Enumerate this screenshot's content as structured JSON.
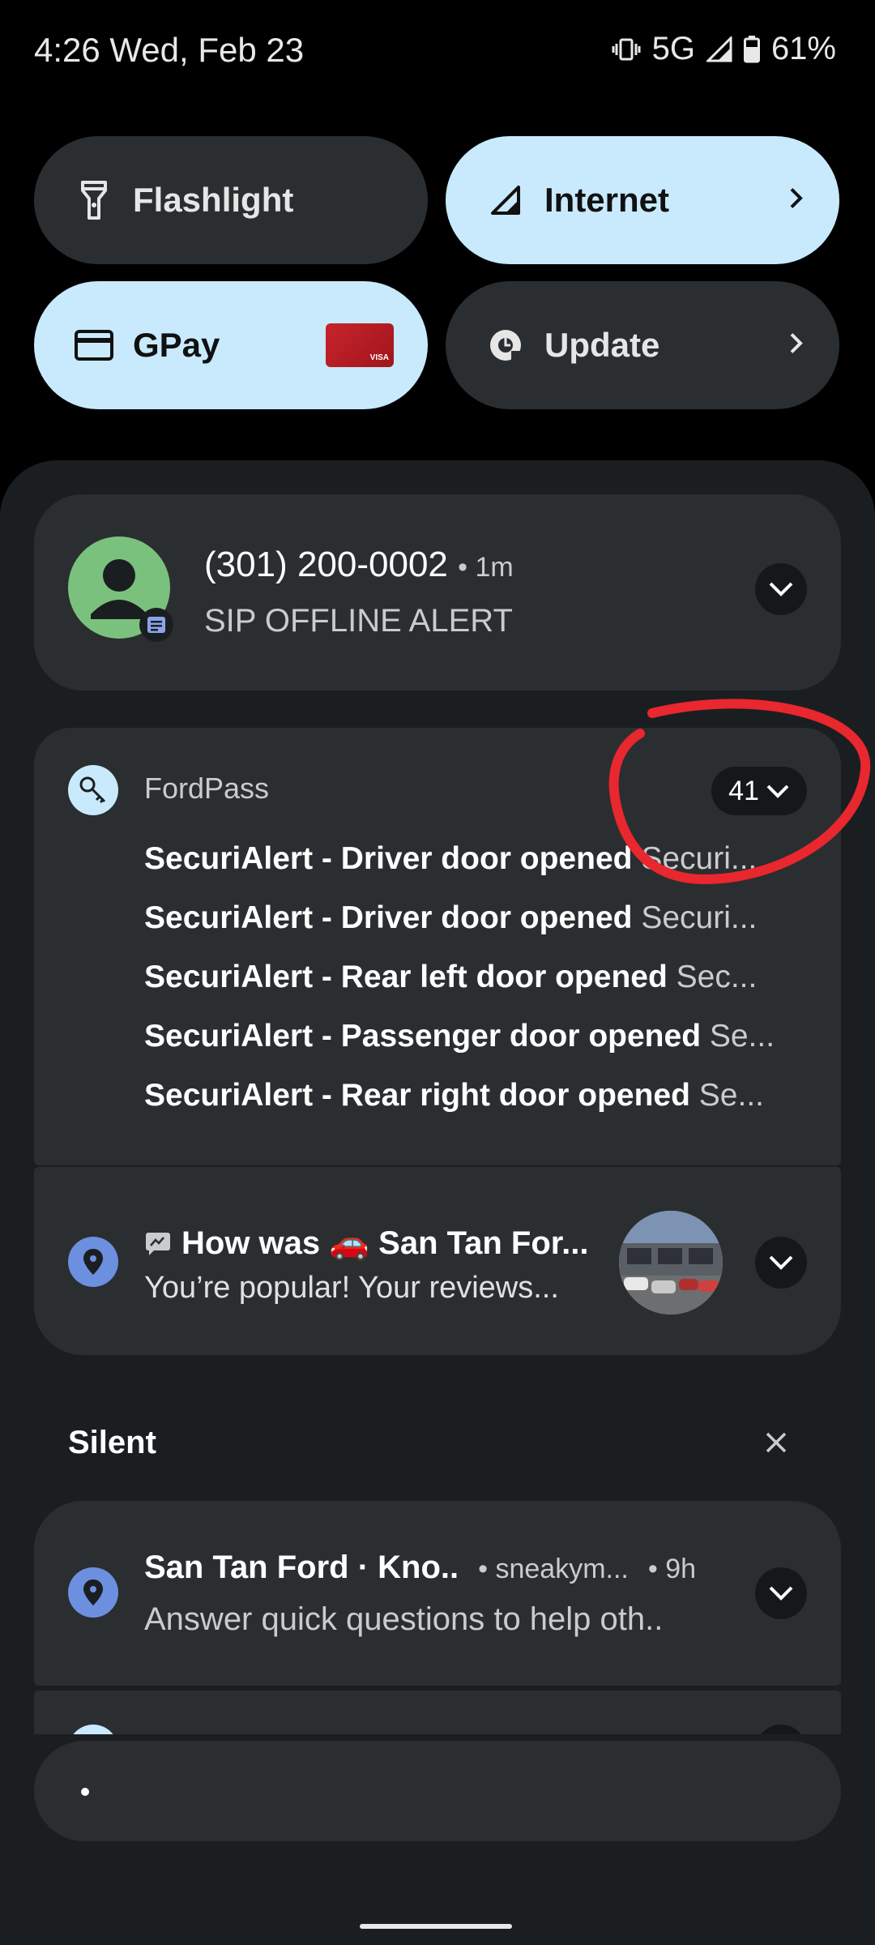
{
  "status_bar": {
    "time": "4:26 Wed, Feb 23",
    "network": "5G",
    "battery": "61%"
  },
  "quick_tiles": [
    {
      "label": "Flashlight",
      "icon": "flashlight-icon",
      "active": false
    },
    {
      "label": "Internet",
      "icon": "signal-icon",
      "active": true
    },
    {
      "label": "GPay",
      "icon": "credit-card-icon",
      "active": true,
      "card_text": "VISA"
    },
    {
      "label": "Update",
      "icon": "update-icon",
      "active": false
    }
  ],
  "notifications": {
    "sms": {
      "title": "(301) 200-0002",
      "time": "1m",
      "text": "SIP OFFLINE ALERT"
    },
    "fordpass": {
      "app": "FordPass",
      "count": "41",
      "items": [
        {
          "title": "SecuriAlert - Driver door opened",
          "body": "Securi..."
        },
        {
          "title": "SecuriAlert - Driver door opened",
          "body": "Securi..."
        },
        {
          "title": "SecuriAlert - Rear left door opened",
          "body": "Sec..."
        },
        {
          "title": "SecuriAlert - Passenger door opened",
          "body": "Se..."
        },
        {
          "title": "SecuriAlert - Rear right door opened",
          "body": "Se..."
        }
      ]
    },
    "maps_review": {
      "title": "How was 🚗 San Tan For...",
      "text": "You’re popular! Your reviews..."
    },
    "silent_header": "Silent",
    "maps_silent": {
      "title": "San Tan Ford · Kno..",
      "account": "• sneakym...",
      "time": "• 9h",
      "text": "Answer quick questions to help oth.."
    }
  },
  "reply_bar": {
    "text": "•"
  },
  "colors": {
    "tile_active": "#c8eafc",
    "tile_inactive": "#2b2e30",
    "shade": "#1b1e21",
    "annotation": "#e8272e"
  }
}
